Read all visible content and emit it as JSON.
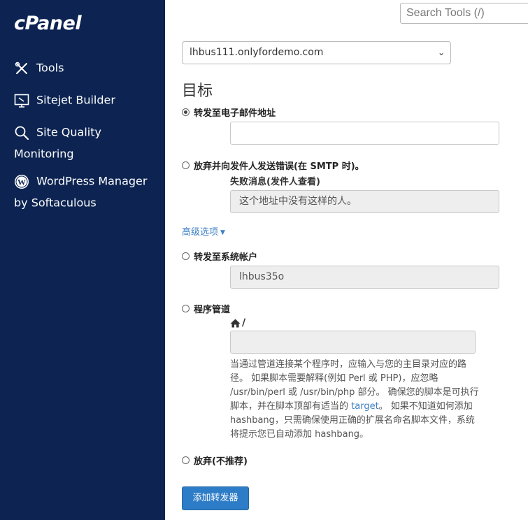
{
  "sidebar": {
    "logo": "cPanel",
    "items": [
      {
        "label": "Tools",
        "icon": "tools-icon"
      },
      {
        "label": "Sitejet Builder",
        "icon": "monitor-icon"
      },
      {
        "label": "Site Quality",
        "label2": "Monitoring",
        "icon": "magnifier-icon"
      },
      {
        "label": "WordPress Manager",
        "label2": "by Softaculous",
        "icon": "wordpress-icon"
      }
    ]
  },
  "header": {
    "search_placeholder": "Search Tools (/)"
  },
  "form": {
    "domain": "lhbus111.onlyfordemo.com",
    "heading": "目标",
    "options": {
      "forward_email": "转发至电子邮件地址",
      "discard_error": "放弃并向发件人发送错误(在 SMTP 时)。",
      "failure_label": "失败消息(发件人查看)",
      "failure_value": "这个地址中没有这样的人。",
      "advanced": "高级选项",
      "forward_system": "转发至系统帐户",
      "system_value": "lhbus35o",
      "pipe": "程序管道",
      "pipe_prefix": "/",
      "help_text_1": "当通过管道连接某个程序时，应输入与您的主目录对应的路径。 如果脚本需要解释(例如 Perl 或 PHP)，应忽略 /usr/bin/perl 或 /usr/bin/php 部分。 确保您的脚本是可执行脚本，并在脚本顶部有适当的 ",
      "help_link": "target",
      "help_text_2": "。 如果不知道如何添加 hashbang，只需确保使用正确的扩展名命名脚本文件，系统将提示您已自动添加 hashbang。",
      "discard": "放弃(不推荐)"
    },
    "submit_label": "添加转发器"
  }
}
